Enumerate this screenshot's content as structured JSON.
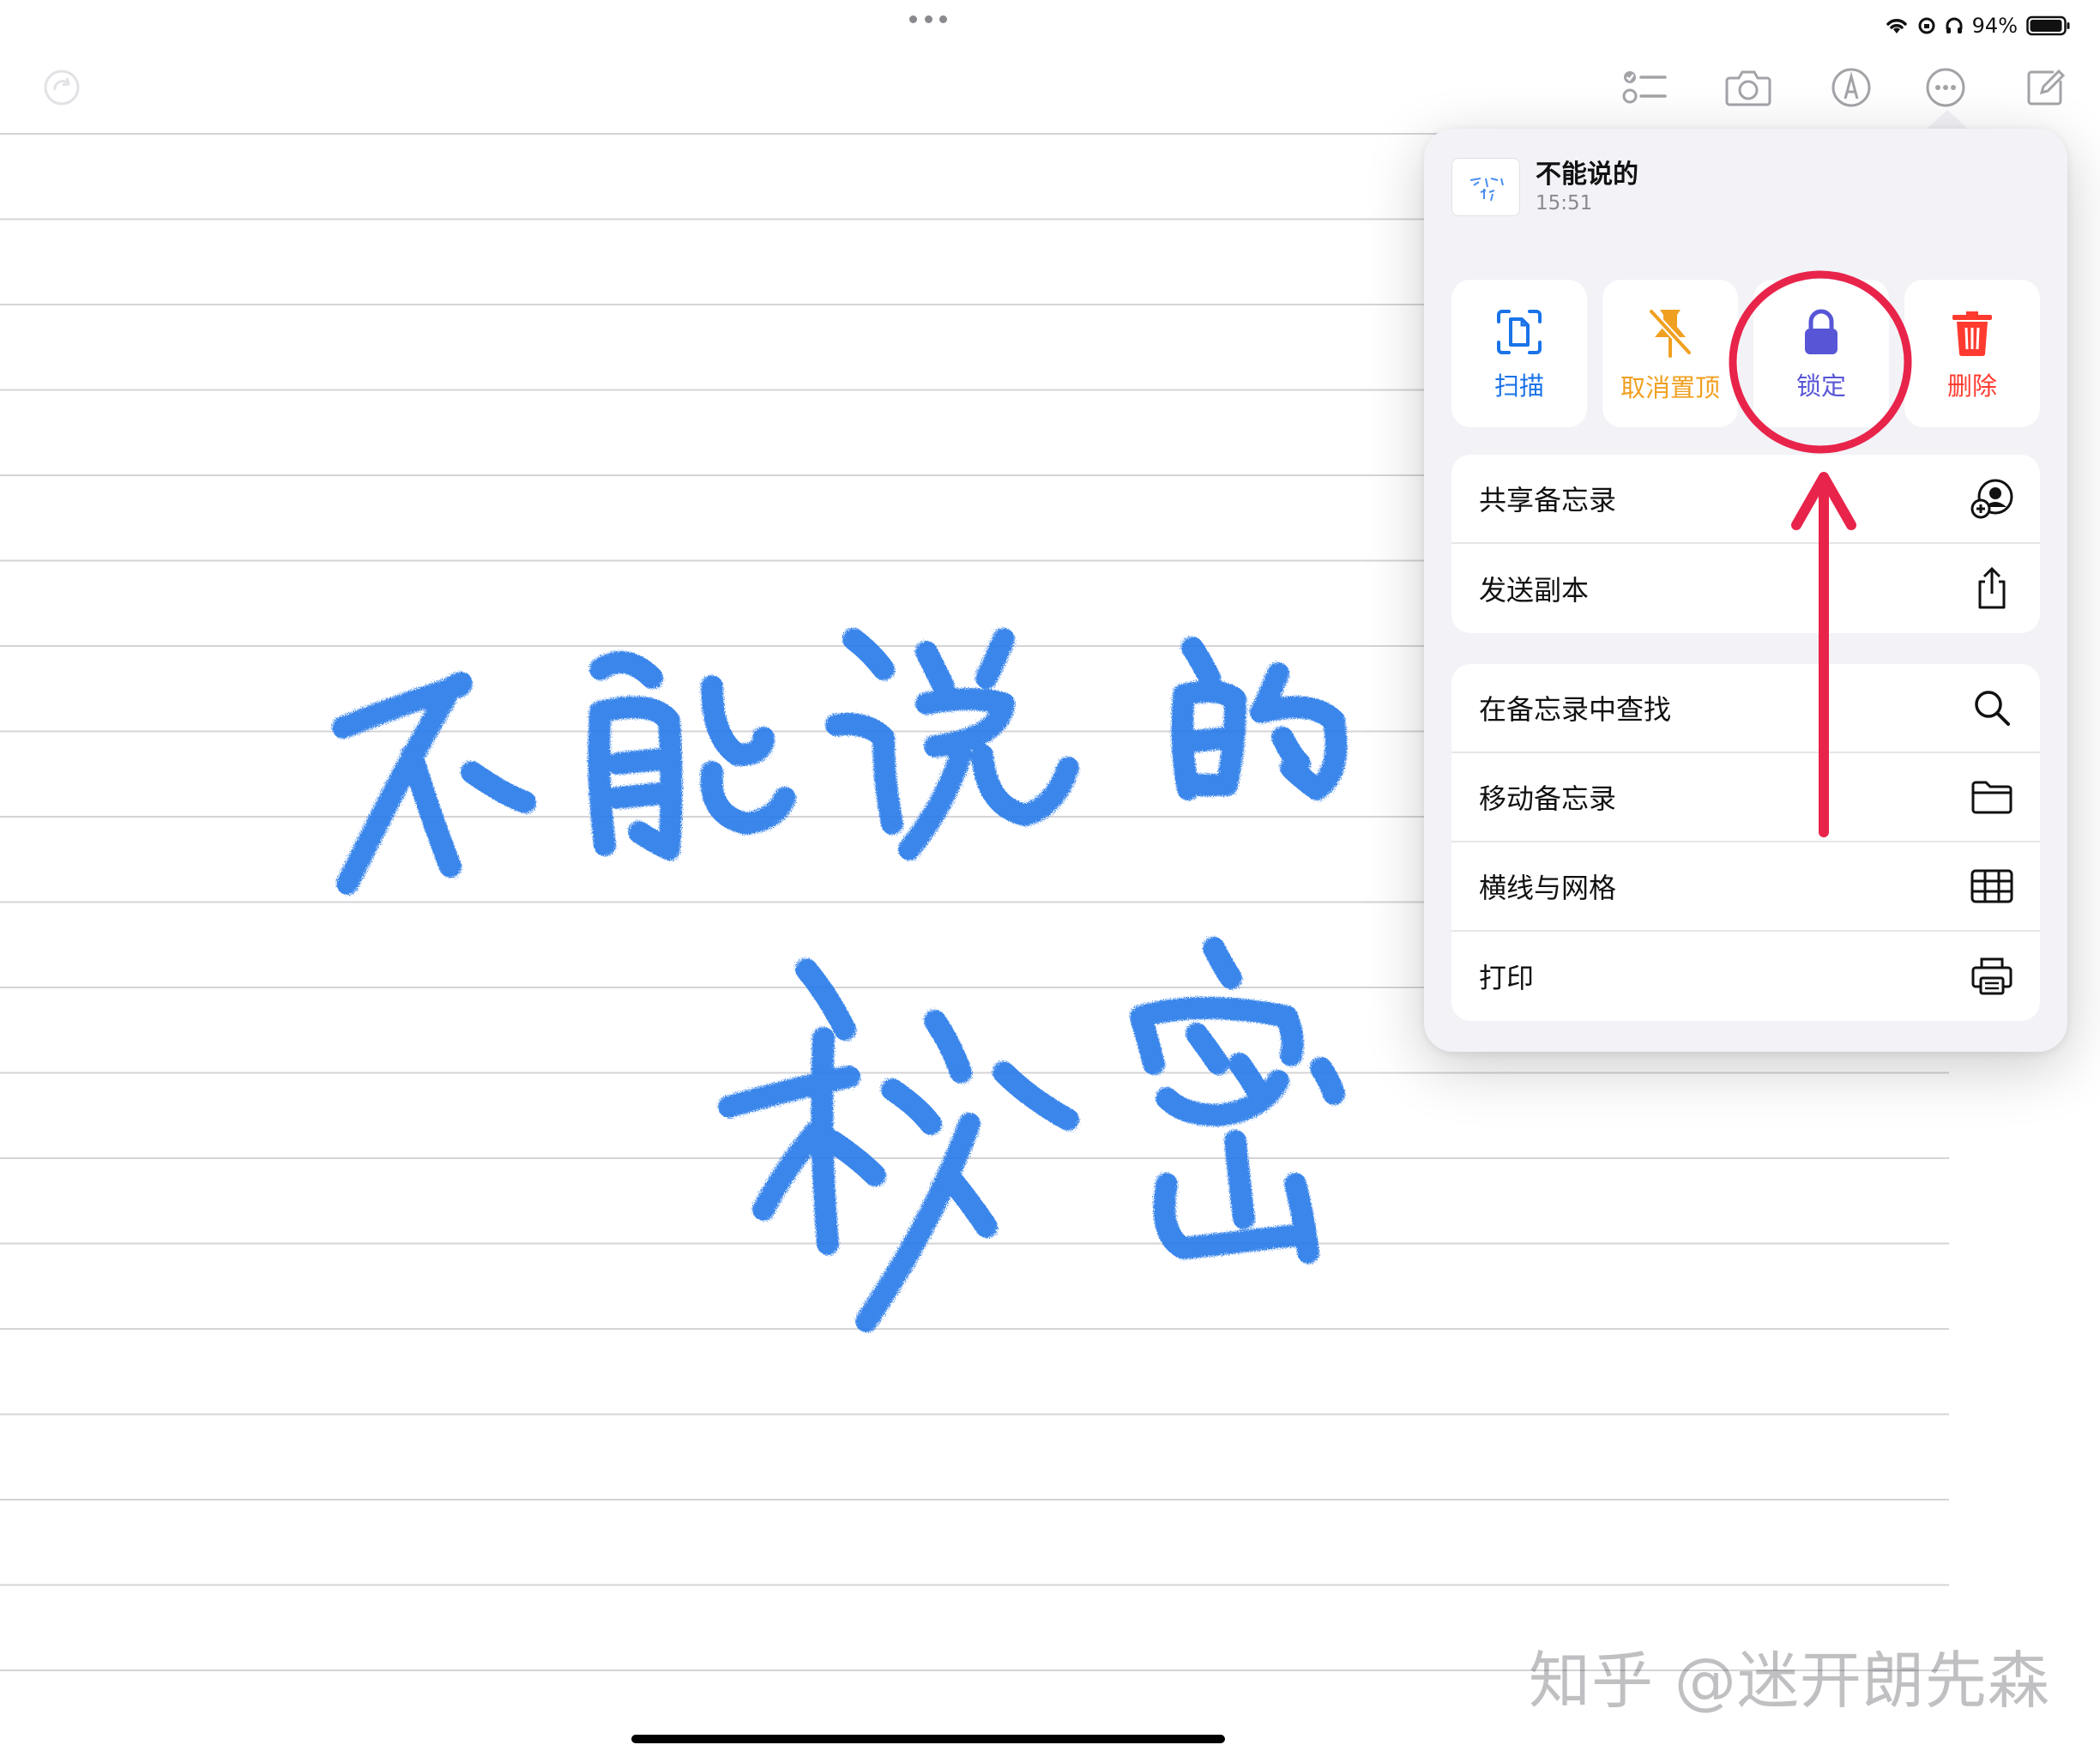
{
  "status_bar": {
    "battery": "94%"
  },
  "toolbar": {
    "icons": [
      "redo-icon",
      "checklist-icon",
      "camera-icon",
      "markup-icon",
      "more-icon",
      "compose-icon"
    ]
  },
  "note": {
    "handwriting_line1": "不能说的",
    "handwriting_line2": "秘密"
  },
  "popover": {
    "note_title": "不能说的",
    "note_time": "15:51",
    "actions": [
      {
        "label": "扫描",
        "color": "#1a73e8",
        "icon": "scan-icon"
      },
      {
        "label": "取消置顶",
        "color": "#f0a020",
        "icon": "unpin-icon"
      },
      {
        "label": "锁定",
        "color": "#5856d6",
        "icon": "lock-icon"
      },
      {
        "label": "删除",
        "color": "#ff3b30",
        "icon": "trash-icon"
      }
    ],
    "group1": [
      {
        "label": "共享备忘录",
        "icon": "share-note-icon"
      },
      {
        "label": "发送副本",
        "icon": "send-copy-icon"
      }
    ],
    "group2": [
      {
        "label": "在备忘录中查找",
        "icon": "search-icon"
      },
      {
        "label": "移动备忘录",
        "icon": "folder-icon"
      },
      {
        "label": "横线与网格",
        "icon": "grid-icon"
      },
      {
        "label": "打印",
        "icon": "printer-icon"
      }
    ]
  },
  "annotation_color": "#e8244a",
  "watermark": "知乎 @迷开朗先森"
}
